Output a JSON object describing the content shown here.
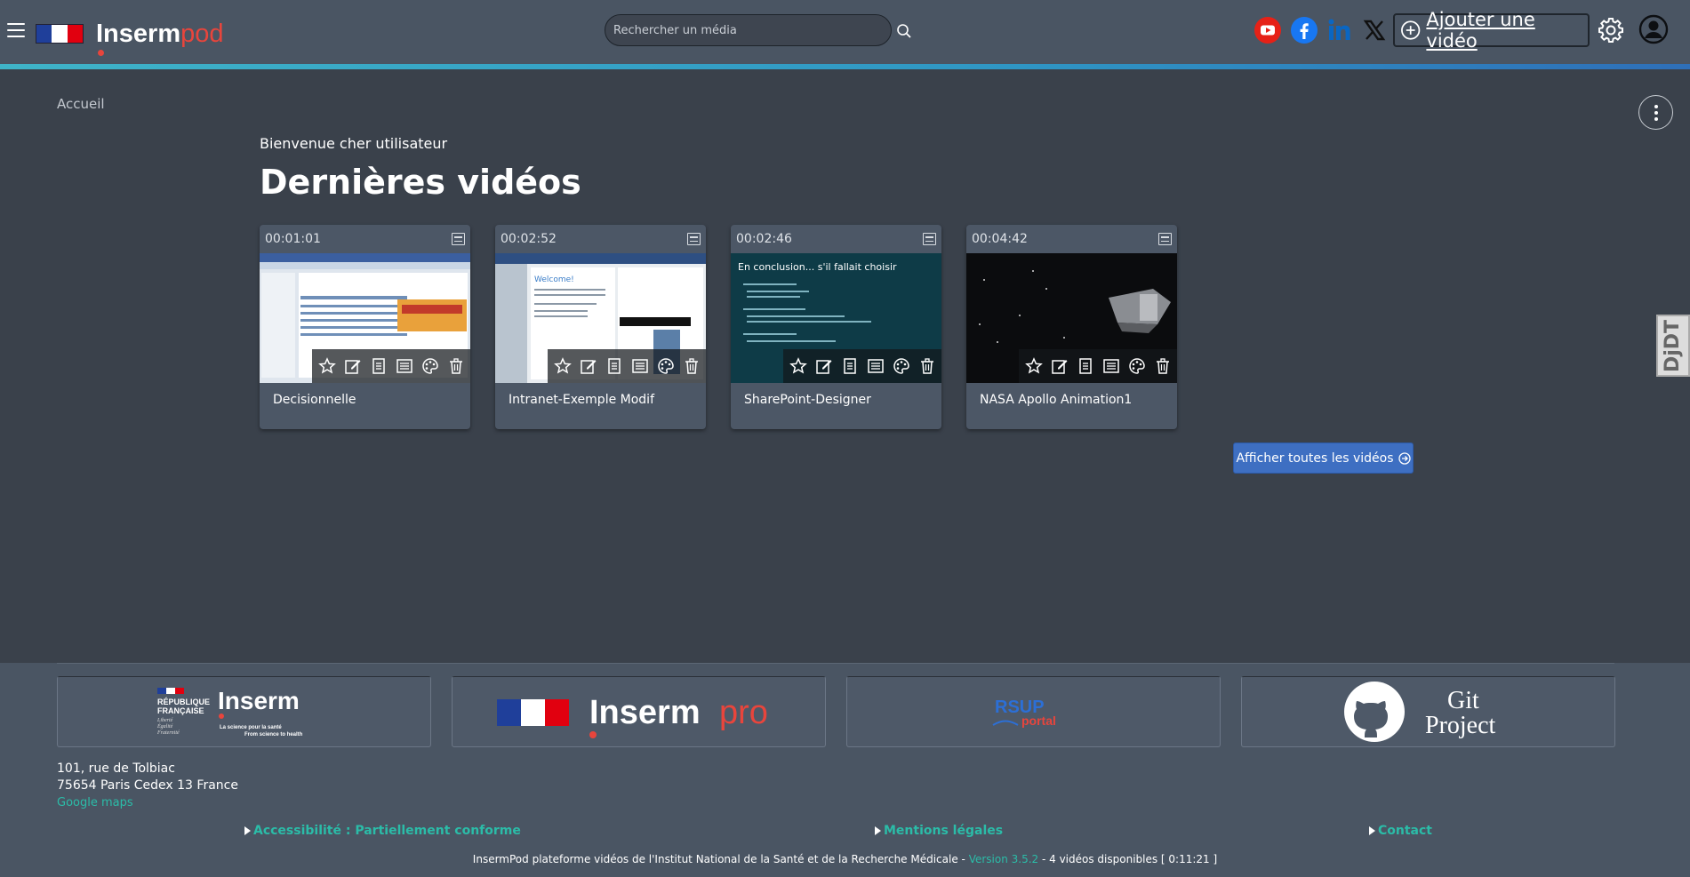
{
  "header": {
    "logo_main": "Inserm",
    "logo_accent": "pod",
    "search_placeholder": "Rechercher un média",
    "add_video_label": "Ajouter une vidéo",
    "social": [
      "youtube-icon",
      "facebook-icon",
      "linkedin-icon",
      "x-icon"
    ],
    "colors": {
      "bar": "#4a5563",
      "accent_line": "#3fb4c8",
      "logo_red": "#e8453c"
    }
  },
  "breadcrumb": "Accueil",
  "welcome": "Bienvenue cher utilisateur",
  "page_title": "Dernières vidéos",
  "videos": [
    {
      "duration": "00:01:01",
      "title": "Decisionnelle"
    },
    {
      "duration": "00:02:52",
      "title": "Intranet-Exemple Modif"
    },
    {
      "duration": "00:02:46",
      "title": "SharePoint-Designer",
      "thumb_text": "En conclusion... s'il fallait choisir"
    },
    {
      "duration": "00:04:42",
      "title": "NASA Apollo Animation1"
    }
  ],
  "card_actions": [
    "star-icon",
    "edit-icon",
    "document-icon",
    "list-icon",
    "palette-icon",
    "trash-icon"
  ],
  "thumb_labels": {
    "welcome_slide": "Welcome!"
  },
  "all_videos_label": "Afficher toutes les vidéos",
  "djdt_label": "DjDT",
  "footer": {
    "partners": {
      "inserm_lines": [
        "RÉPUBLIQUE",
        "FRANÇAISE"
      ],
      "inserm_motto": [
        "Liberté",
        "Égalité",
        "Fraternité"
      ],
      "inserm_name": "Inserm",
      "inserm_tagline": "La science pour la santé",
      "inserm_tagline_en": "From science to health",
      "inserm_pro_main": "Inserm",
      "inserm_pro_accent": "pro",
      "rsup": "RSUP",
      "rsup_portal": "portal",
      "git": [
        "Git",
        "Project"
      ]
    },
    "address": [
      "101, rue de Tolbiac",
      "75654 Paris Cedex 13 France"
    ],
    "gmaps": "Google maps",
    "links": [
      "Accessibilité : Partiellement conforme",
      "Mentions légales",
      "Contact"
    ],
    "copyright_pre": "InsermPod plateforme vidéos de l'Institut National de la Santé et de la Recherche Médicale - ",
    "version": "Version 3.5.2",
    "copyright_post": " - 4 vidéos disponibles [ 0:11:21 ]",
    "link_color": "#2bbca8"
  }
}
